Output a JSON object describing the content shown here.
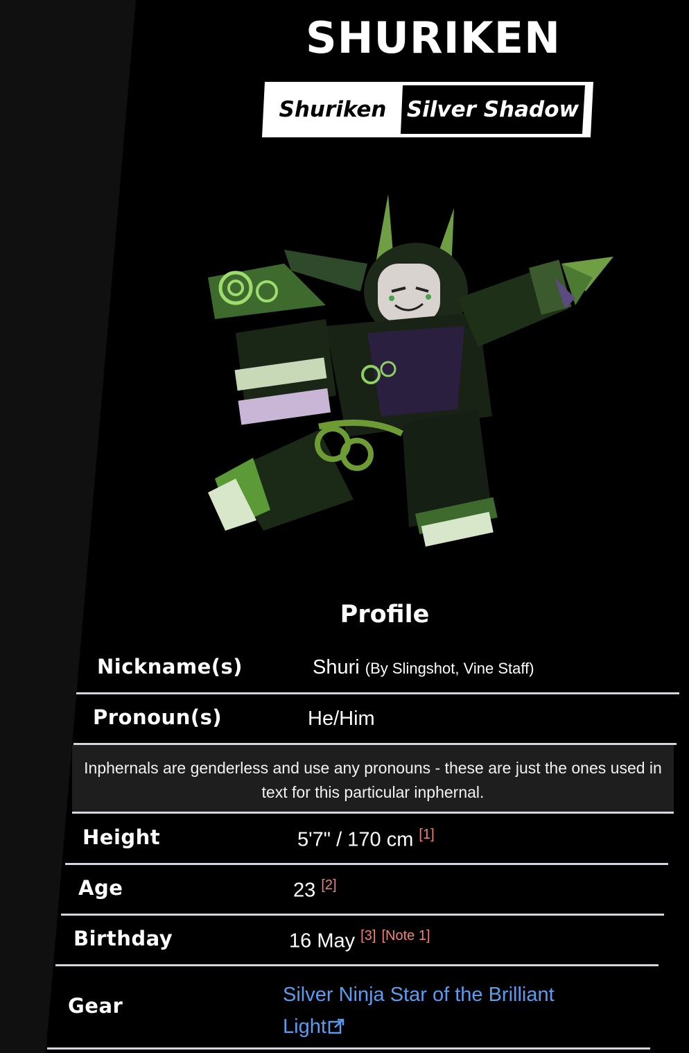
{
  "page": {
    "title": "SHURIKEN",
    "tabs": [
      {
        "label": "Shuriken",
        "active": true
      },
      {
        "label": "Silver Shadow",
        "active": false
      }
    ]
  },
  "profile": {
    "heading": "Profile",
    "nickname": {
      "label": "Nickname(s)",
      "value": "Shuri",
      "detail": "(By Slingshot, Vine Staff)"
    },
    "pronouns": {
      "label": "Pronoun(s)",
      "value": "He/Him"
    },
    "pronoun_note": "Inphernals are genderless and use any pronouns - these are just the ones used in text for this particular inphernal.",
    "height": {
      "label": "Height",
      "value": "5'7\" / 170 cm",
      "refs": [
        "[1]"
      ]
    },
    "age": {
      "label": "Age",
      "value": "23",
      "refs": [
        "[2]"
      ]
    },
    "birthday": {
      "label": "Birthday",
      "value": "16 May",
      "refs": [
        "[3]",
        "[Note 1]"
      ]
    },
    "gear": {
      "label": "Gear",
      "value_line1": "Silver Ninja Star of the Brilliant",
      "value_line2": "Light",
      "icon": "external-link-icon"
    }
  },
  "colors": {
    "background": "#000000",
    "link": "#5b9cf0",
    "reference": "#f0827a",
    "divider": "#d3d6dc",
    "character_green": "#5a8a3a"
  }
}
